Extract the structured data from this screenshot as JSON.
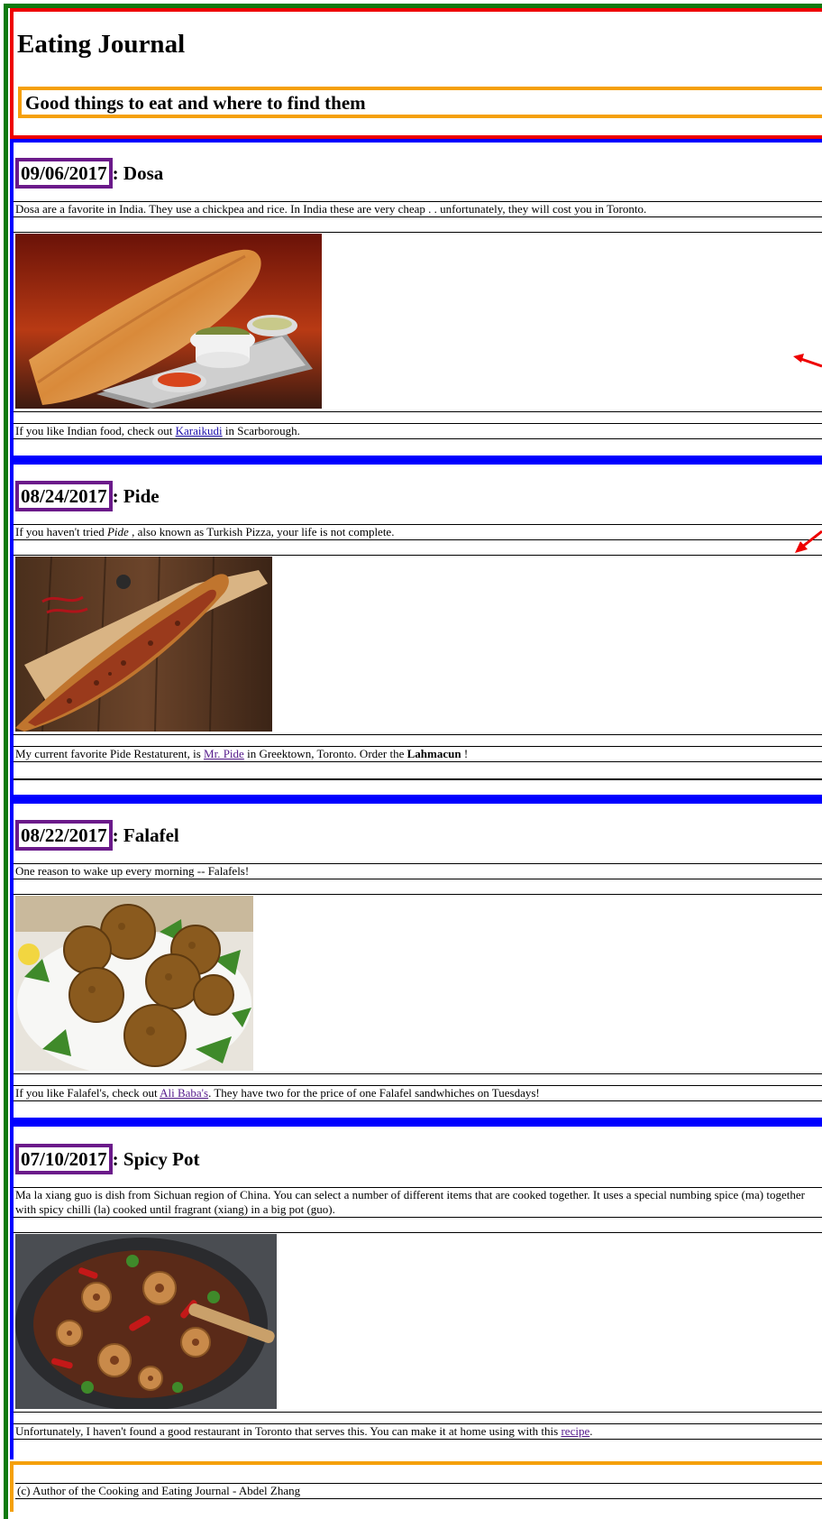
{
  "header": {
    "title": "Eating Journal",
    "tagline": "Good things to eat and where to find them"
  },
  "entries": [
    {
      "date": "09/06/2017",
      "name": ": Dosa",
      "intro": "Dosa are a favorite in India. They use a chickpea and rice. In India these are very cheap . . unfortunately, they will cost you in Toronto.",
      "image_icon": "dosa-photo",
      "outro_pre": "If you like Indian food, check out ",
      "outro_link": "Karaikudi",
      "outro_post": " in Scarborough."
    },
    {
      "date": "08/24/2017",
      "name": ": Pide",
      "intro_pre": "If you haven't tried ",
      "intro_em": "Pide",
      "intro_post": " , also known as Turkish Pizza, your life is not complete.",
      "image_icon": "pide-photo",
      "outro_pre": "My current favorite Pide Restaturent, is ",
      "outro_link": "Mr. Pide",
      "outro_mid": " in Greektown, Toronto. Order the ",
      "outro_strong": "Lahmacun",
      "outro_post": " !"
    },
    {
      "date": "08/22/2017",
      "name": ": Falafel",
      "intro": "One reason to wake up every morning -- Falafels!",
      "image_icon": "falafel-photo",
      "outro_pre": "If you like Falafel's, check out ",
      "outro_link": "Ali Baba's",
      "outro_post": ". They have two for the price of one Falafel sandwhiches on Tuesdays!"
    },
    {
      "date": "07/10/2017",
      "name": ": Spicy Pot",
      "intro": "Ma la xiang guo is dish from Sichuan region of China. You can select a number of different items that are cooked together. It uses a special numbing spice (ma) together with spicy chilli (la) cooked until fragrant (xiang) in a big pot (guo).",
      "image_icon": "spicy-pot-photo",
      "outro_pre": "Unfortunately, I haven't found a good restaurant in Toronto that serves this. You can make it at home using with this ",
      "outro_link": "recipe",
      "outro_post": "."
    }
  ],
  "footer": {
    "text": "(c) Author of the Cooking and Eating Journal - Abdel Zhang"
  },
  "colors": {
    "page_border": "#0f7a0f",
    "header_border": "#e00000",
    "tagline_border": "#f5a00a",
    "section_bar": "#0000ff",
    "date_border": "#6b1a8a",
    "link": "#1a0dab",
    "visited_link": "#551a8b",
    "annotation_arrow": "#e00000"
  }
}
